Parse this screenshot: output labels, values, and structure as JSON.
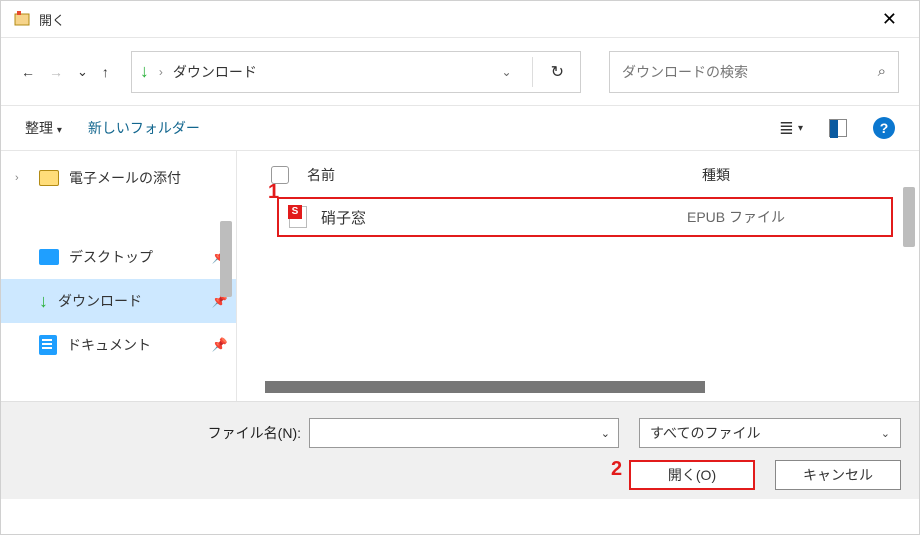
{
  "title": "開く",
  "breadcrumb": {
    "path": "ダウンロード"
  },
  "search": {
    "placeholder": "ダウンロードの検索"
  },
  "commands": {
    "organize": "整理",
    "newfolder": "新しいフォルダー"
  },
  "sidebar": {
    "email": "電子メールの添付",
    "desktop": "デスクトップ",
    "downloads": "ダウンロード",
    "documents": "ドキュメント"
  },
  "columns": {
    "name": "名前",
    "kind": "種類"
  },
  "file": {
    "name": "硝子窓",
    "kind": "EPUB ファイル"
  },
  "annotations": {
    "one": "1",
    "two": "2"
  },
  "bottom": {
    "label": "ファイル名(N):",
    "filetype": "すべてのファイル",
    "open": "開く(O)",
    "cancel": "キャンセル"
  }
}
